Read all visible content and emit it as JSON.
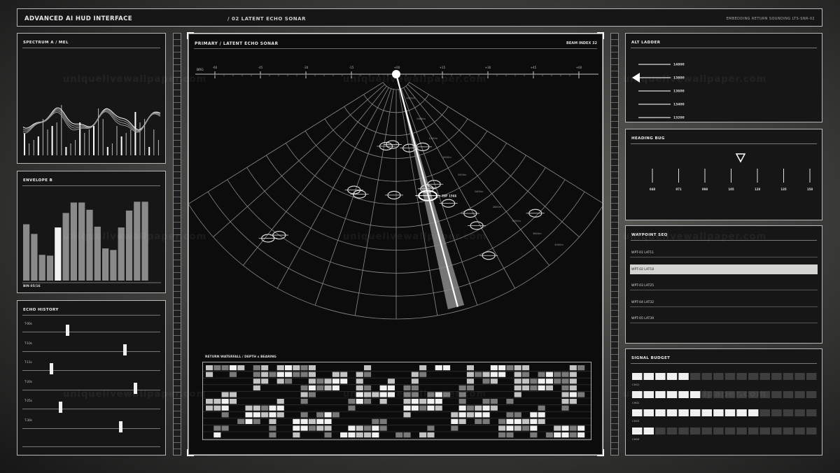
{
  "topbar": {
    "title": "ADVANCED AI HUD INTERFACE",
    "subtitle": "/ 02 LATENT ECHO SONAR",
    "right_text": "EMBEDDING RETURN SOUNDING   LTS-SNR-02"
  },
  "spectrum": {
    "title": "SPECTRUM A / MEL"
  },
  "envelope": {
    "title": "ENVELOPE B",
    "footer": "BIN 05/16",
    "bars": [
      0.7,
      0.58,
      0.32,
      0.31,
      0.66,
      0.84,
      0.97,
      0.97,
      0.88,
      0.67,
      0.4,
      0.38,
      0.66,
      0.87,
      0.98,
      0.98
    ],
    "highlight_index": 4
  },
  "echo_history": {
    "title": "ECHO HISTORY",
    "rows": [
      {
        "label": "T-00s",
        "pos": 0.31
      },
      {
        "label": "T-10s",
        "pos": 0.74
      },
      {
        "label": "T-11s",
        "pos": 0.19
      },
      {
        "label": "T-20s",
        "pos": 0.82
      },
      {
        "label": "T-25s",
        "pos": 0.26
      },
      {
        "label": "T-30s",
        "pos": 0.71
      }
    ]
  },
  "sonar": {
    "title": "PRIMARY / LATENT ECHO SONAR",
    "beam_label": "BEAM INDEX 32",
    "brg_label": "BRG",
    "scale_ticks": [
      "-60",
      "-45",
      "-30",
      "-15",
      "+00",
      "+15",
      "+30",
      "+45",
      "+60"
    ],
    "range_labels": [
      "0400m",
      "0800m",
      "1200m",
      "1600m",
      "2000m",
      "2400m",
      "2800m",
      "3200m",
      "3600m",
      "4000m"
    ],
    "target_label": "EBF 1566",
    "beam_angle_deg": 15,
    "targets": [
      {
        "angle": -8,
        "range": 0.25
      },
      {
        "angle": -3,
        "range": 0.24
      },
      {
        "angle": 10,
        "range": 0.26
      },
      {
        "angle": 20,
        "range": 0.27
      },
      {
        "angle": -20,
        "range": 0.47
      },
      {
        "angle": -17,
        "range": 0.48
      },
      {
        "angle": -1,
        "range": 0.46
      },
      {
        "angle": 15,
        "range": 0.45
      },
      {
        "angle": 19,
        "range": 0.44
      },
      {
        "angle": 22,
        "range": 0.54
      },
      {
        "angle": 45,
        "range": 0.79
      },
      {
        "angle": -38,
        "range": 0.84
      },
      {
        "angle": -36,
        "range": 0.8
      },
      {
        "angle": 28,
        "range": 0.68
      },
      {
        "angle": 28,
        "range": 0.62
      },
      {
        "angle": 27,
        "range": 0.82
      }
    ],
    "waterfall_title": "RETURN WATERFALL / DEPTH x BEARING"
  },
  "alt_ladder": {
    "title": "ALT LADDER",
    "values": [
      "14800",
      "13800",
      "13600",
      "13400",
      "13200"
    ],
    "selected_index": 1
  },
  "heading_bug": {
    "title": "HEADING BUG",
    "ticks": [
      "048",
      "071",
      "098",
      "105",
      "128",
      "135",
      "158"
    ],
    "bug_pos": 0.56
  },
  "waypoints": {
    "title": "WAYPOINT SEQ",
    "items": [
      "WPT-01 LAT11",
      "WPT-02 LAT18",
      "WPT-03 LAT25",
      "WPT-04 LAT32",
      "WPT-05 LAT39"
    ],
    "selected_index": 1
  },
  "signal_budget": {
    "title": "SIGNAL BUDGET",
    "channels": [
      {
        "label": "CH01",
        "filled": 5
      },
      {
        "label": "CH02",
        "filled": 6
      },
      {
        "label": "CH03",
        "filled": 11
      },
      {
        "label": "CH04",
        "filled": 2
      }
    ],
    "total_cells": 16
  },
  "watermark_text": "uniquelivewallpaper.com"
}
